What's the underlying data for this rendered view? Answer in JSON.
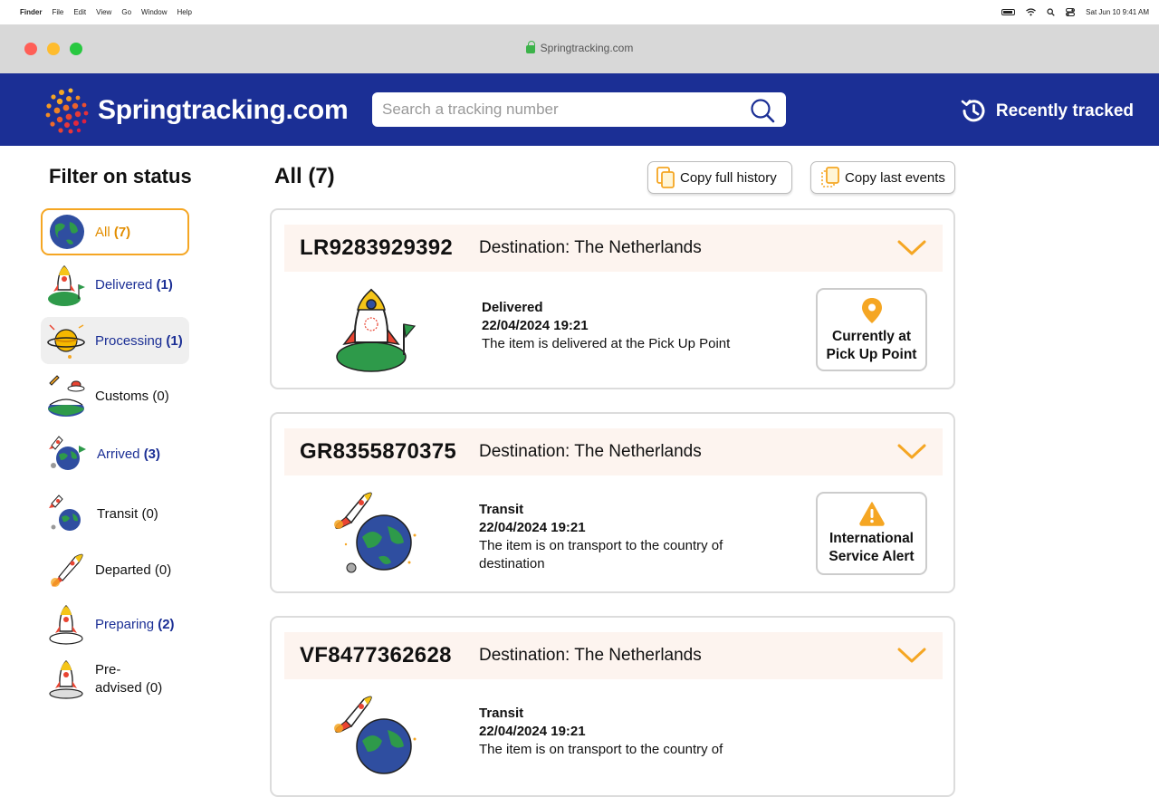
{
  "menubar": {
    "apple": "",
    "items": [
      "Finder",
      "File",
      "Edit",
      "View",
      "Go",
      "Window",
      "Help"
    ],
    "datetime": "Sat Jun 10  9:41 AM"
  },
  "browser": {
    "url": "Springtracking.com"
  },
  "header": {
    "brand": "Springtracking.com",
    "search_placeholder": "Search a tracking number",
    "recent_label": "Recently tracked"
  },
  "filter": {
    "title": "Filter on status",
    "items": [
      {
        "name": "All",
        "count": "(7)"
      },
      {
        "name": "Delivered",
        "count": "(1)"
      },
      {
        "name": "Processing",
        "count": "(1)"
      },
      {
        "name": "Customs",
        "count": "(0)"
      },
      {
        "name": "Arrived",
        "count": "(3)"
      },
      {
        "name": "Transit",
        "count": "(0)"
      },
      {
        "name": "Departed",
        "count": "(0)"
      },
      {
        "name": "Preparing",
        "count": "(2)"
      },
      {
        "name": "Pre-\nadvised",
        "count": "(0)"
      }
    ]
  },
  "content": {
    "title": "All (7)",
    "copy_full": "Copy full history",
    "copy_last": "Copy last events"
  },
  "shipments": [
    {
      "tracking": "LR9283929392",
      "destination": "Destination: The Netherlands",
      "status": "Delivered",
      "date": "22/04/2024 19:21",
      "desc": "The item is delivered at the Pick Up Point",
      "badge_line1": "Currently at",
      "badge_line2": "Pick Up Point",
      "badge_icon": "location-pin-icon"
    },
    {
      "tracking": "GR8355870375",
      "destination": "Destination: The Netherlands",
      "status": "Transit",
      "date": "22/04/2024 19:21",
      "desc": "The item is on transport to the country of destination",
      "badge_line1": "International",
      "badge_line2": "Service Alert",
      "badge_icon": "warning-icon"
    },
    {
      "tracking": "VF8477362628",
      "destination": "Destination: The Netherlands",
      "status": "Transit",
      "date": "22/04/2024 19:21",
      "desc": "The item is on transport to the country of",
      "badge_line1": "",
      "badge_line2": "",
      "badge_icon": ""
    }
  ],
  "colors": {
    "header_bg": "#1b2f95",
    "accent": "#f5a623",
    "card_head_bg": "#fdf4ef"
  }
}
